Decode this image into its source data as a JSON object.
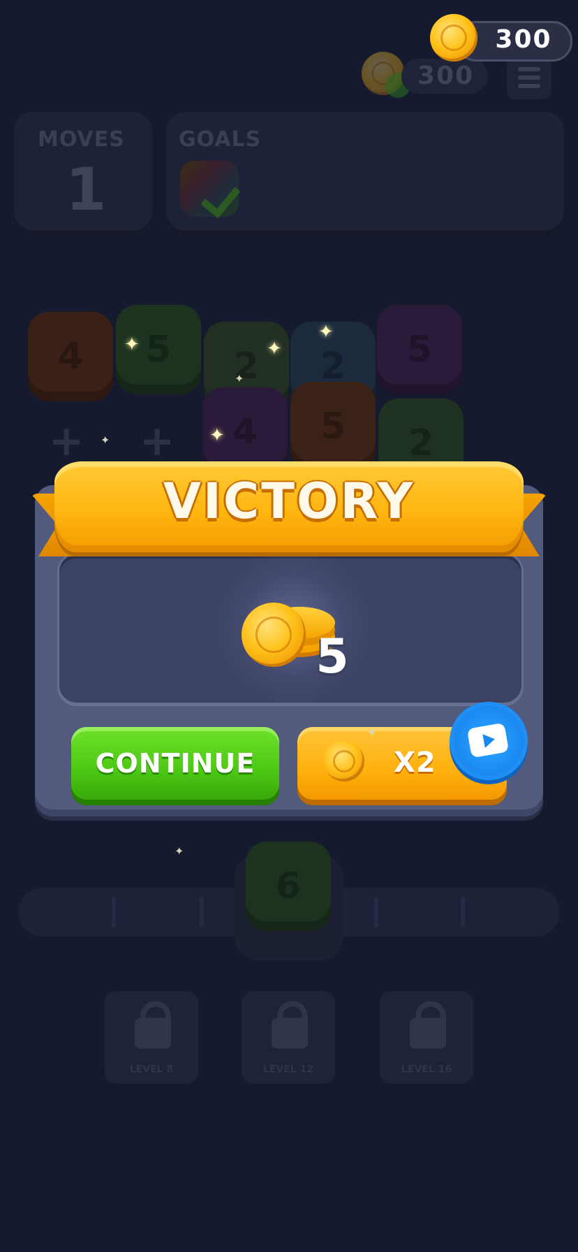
{
  "currency": {
    "coins": "300",
    "background_coins": "300"
  },
  "hud": {
    "moves_label": "MOVES",
    "moves_value": "1",
    "goals_label": "GOALS"
  },
  "board": {
    "tiles": [
      {
        "label": "4",
        "color": "#3b2018"
      },
      {
        "label": "5",
        "color": "#1d3320"
      },
      {
        "label": "2",
        "color": "#223024"
      },
      {
        "label": "2",
        "color": "#1c2a3e"
      },
      {
        "label": "5",
        "color": "#2b1b3a"
      },
      {
        "label": "4",
        "color": "#2b1b3a"
      },
      {
        "label": "5",
        "color": "#3b2218"
      },
      {
        "label": "2",
        "color": "#1f3222"
      }
    ],
    "next_tile": "6"
  },
  "levels": [
    {
      "label": "LEVEL 8"
    },
    {
      "label": "LEVEL 12"
    },
    {
      "label": "LEVEL 16"
    }
  ],
  "dialog": {
    "title": "VICTORY",
    "reward_amount": "5",
    "continue_label": "CONTINUE",
    "double_label": "X2"
  },
  "colors": {
    "ribbon": "#ffb60f",
    "continue_button": "#4cc814",
    "double_button": "#ffb10c",
    "video_badge": "#1a88f2"
  },
  "icons": [
    "coin-icon",
    "menu-icon",
    "lock-icon",
    "video-ad-icon",
    "checkmark-icon"
  ]
}
